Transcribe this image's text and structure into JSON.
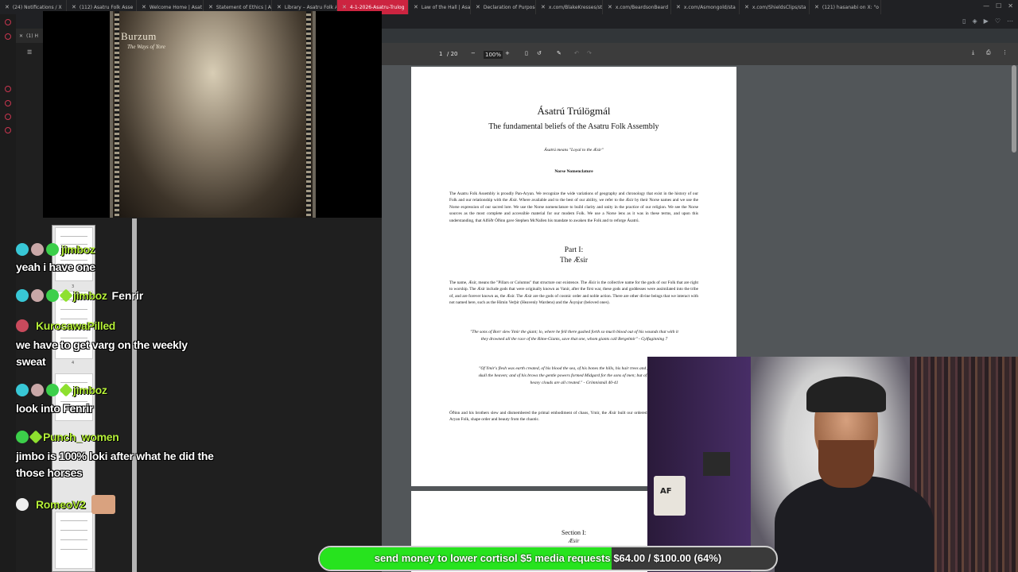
{
  "browser": {
    "tabs": [
      {
        "label": "(24) Notifications / X",
        "active": false
      },
      {
        "label": "(112) Asatru Folk Asse",
        "active": false
      },
      {
        "label": "Welcome Home | Asat",
        "active": false
      },
      {
        "label": "Statement of Ethics | A",
        "active": false
      },
      {
        "label": "Library – Asatru Folk A",
        "active": false
      },
      {
        "label": "4-1-2026-Asatru-Trulog",
        "active": true
      },
      {
        "label": "Law of the Hall | Asat",
        "active": false
      },
      {
        "label": "Declaration of Purpose",
        "active": false
      },
      {
        "label": "x.com/BlakeKresses/st",
        "active": false
      },
      {
        "label": "x.com/BeardsonBeard",
        "active": false
      },
      {
        "label": "x.com/Asmongold/sta",
        "active": false
      },
      {
        "label": "x.com/ShieldsClips/sta",
        "active": false
      },
      {
        "label": "(121) hasanabi on X: \"o",
        "active": false
      }
    ],
    "side_tab": "(1) H",
    "accent_color": "#cc2440"
  },
  "pdf": {
    "page_current": "1",
    "page_total": "/ 20",
    "zoom": "100%",
    "page1": {
      "title": "Ásatrú Trúlögmál",
      "subtitle": "The fundamental beliefs of the Asatru Folk Assembly",
      "meaning": "Ásatrú means \"Loyal to the Æsir\"",
      "section_heading": "Norse Nomenclature",
      "para1": "The Asatru Folk Assembly is proudly Pan-Aryan. We recognize the wide variations of geography and chronology that exist in the history of our Folk and our relationship with the Æsir. Where available and to the best of our ability, we refer to the Æsir by their Norse names and we use the Norse expression of our sacred lore. We use the Norse nomenclature to build clarity and unity in the practice of our religion. We see the Norse sources as the most complete and accessible material for our modern Folk. We use a Norse lens as it was in these terms, and upon this understanding, that Alföðr Óðinn gave Stephen McNallen his mandate to awaken the Folk and to reforge Ásatrú.",
      "part": "Part I:",
      "part_name": "The Æsir",
      "para2": "The name, Æsir, means the \"Pillars or Columns\" that structure our existence. The Æsir is the collective name for the gods of our Folk that are right to worship. The Æsir include gods that were originally known as Vanir, after the first war, these gods and goddesses were assimilated into the tribe of, and are forever known as, the Æsir. The Æsir are the gods of cosmic order and noble action. There are other divine beings that we interact with not named here, such as the Himin Verþir (Heavenly Wardens) and the Ásynjur (beloved ones).",
      "quote1": "\"The sons of Borr slew Ymir the giant; lo, where he fell there gushed forth so much blood out of his wounds that with it they drowned all the race of the Rime-Giants, save that one, whom giants call Bergelmir\" - Gylfaginning 7",
      "quote2": "\"Of Ymir's flesh was earth created, of his blood the sea, of his bones the hills, his hair trees and plants, of his skull the heaven; and of his brows the gentle powers formed Midgard for the sons of men; but of his brain the heavy clouds are all created.\" - Grímnismál 40-41",
      "para3": "Óðinn and his brothers slew and dismembered the primal embodiment of chaos, Ymir, the Æsir built our ordered existence. The Æsir, and our Aryan Folk, shape order and beauty from the chaotic."
    },
    "page2": {
      "section": "Section I:",
      "name": "Æsir"
    }
  },
  "video": {
    "band": "Burzum",
    "album": "The Ways of Yore"
  },
  "chat": {
    "messages": [
      {
        "user": "jimboz",
        "text": "yeah i have one",
        "inline": ""
      },
      {
        "user": "jimboz",
        "text": "",
        "inline": "Fenrir"
      },
      {
        "user": "KurosawaPilled",
        "text": "we have to get varg on the weekly sweat",
        "inline": ""
      },
      {
        "user": "jimboz",
        "text": "look into Fenrir",
        "inline": ""
      },
      {
        "user": "Punch_women",
        "text": "jimbo is 100% loki after what he did the those horses",
        "inline": ""
      },
      {
        "user": "RomeoV2",
        "text": "",
        "inline": ""
      }
    ],
    "name_color": "#b6f03a"
  },
  "thumbs": {
    "numbers": [
      "3",
      "4"
    ]
  },
  "cam": {
    "mug_text": "AF"
  },
  "goal": {
    "text": "send money to lower cortisol $5 media requests $64.00 / $100.00 (64%)",
    "progress": 0.64,
    "color": "#27e31e"
  }
}
